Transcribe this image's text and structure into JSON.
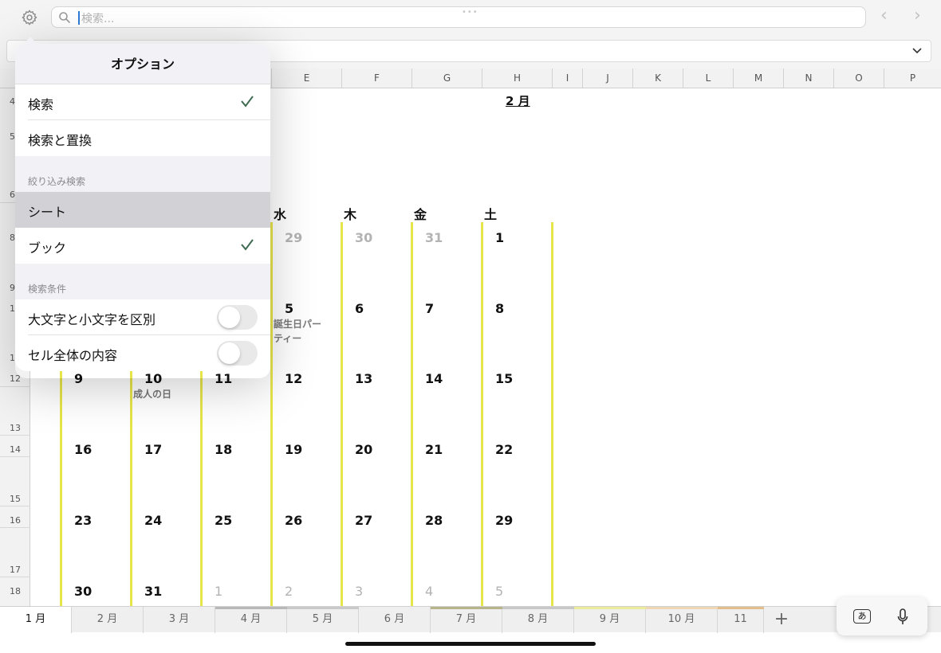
{
  "toolbar": {
    "search_placeholder": "検索..."
  },
  "sheet": {
    "month_title": "2 月",
    "weekdays": [
      "水",
      "木",
      "金",
      "土"
    ],
    "columns": [
      "E",
      "F",
      "G",
      "H",
      "I",
      "J",
      "K",
      "L",
      "M",
      "N",
      "O",
      "P"
    ],
    "rows": [
      "4",
      "5",
      "6",
      "8",
      "9",
      "1",
      "1",
      "12",
      "13",
      "14",
      "15",
      "16",
      "17",
      "18"
    ],
    "days": [
      [
        "29",
        "30",
        "31",
        "1"
      ],
      [
        "5",
        "6",
        "7",
        "8"
      ],
      [
        "9",
        "10",
        "11",
        "12",
        "13",
        "14",
        "15"
      ],
      [
        "16",
        "17",
        "18",
        "19",
        "20",
        "21",
        "22"
      ],
      [
        "23",
        "24",
        "25",
        "26",
        "27",
        "28",
        "29"
      ],
      [
        "30",
        "31",
        "1",
        "2",
        "3",
        "4",
        "5"
      ]
    ],
    "events": {
      "birthday": "誕生日パー\nティー",
      "coming_of_age": "成人の日"
    },
    "accent_color": "#e8e54a"
  },
  "options_popover": {
    "title": "オプション",
    "items": [
      {
        "label": "検索",
        "checked": true
      },
      {
        "label": "検索と置換",
        "checked": false
      }
    ],
    "filter_section": "絞り込み検索",
    "filter_items": [
      {
        "label": "シート",
        "checked": false,
        "highlighted": true
      },
      {
        "label": "ブック",
        "checked": true
      }
    ],
    "condition_section": "検索条件",
    "condition_items": [
      {
        "label": "大文字と小文字を区別",
        "on": false
      },
      {
        "label": "セル全体の内容",
        "on": false
      }
    ]
  },
  "tabs": [
    "1 月",
    "2 月",
    "3 月",
    "4 月",
    "5 月",
    "6 月",
    "7 月",
    "8 月",
    "9 月",
    "10 月",
    "11"
  ],
  "active_tab": "1 月",
  "keyboard": {
    "input_label": "あ"
  }
}
